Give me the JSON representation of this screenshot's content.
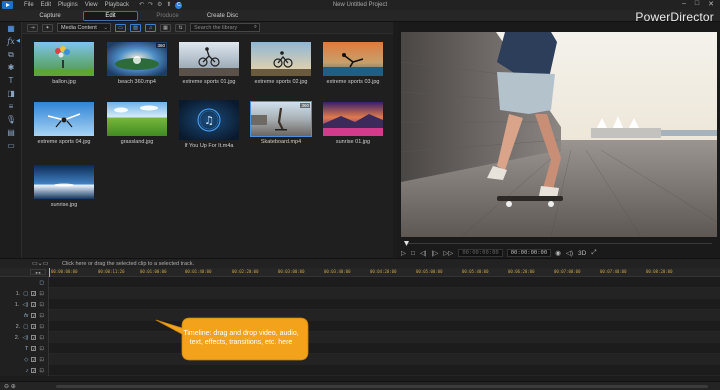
{
  "menu": {
    "items": [
      "File",
      "Edit",
      "Plugins",
      "View",
      "Playback"
    ]
  },
  "window": {
    "project_title": "New Untitled Project",
    "brand": "PowerDirector"
  },
  "modes": [
    "Capture",
    "Edit",
    "Produce",
    "Create Disc"
  ],
  "library": {
    "dropdown_value": "Media Content",
    "search_placeholder": "Search the library",
    "items": [
      {
        "label": "ballon.jpg"
      },
      {
        "label": "beach 360.mp4",
        "badge": "360"
      },
      {
        "label": "extreme sports 01.jpg"
      },
      {
        "label": "extreme sports 02.jpg"
      },
      {
        "label": "extreme sports 03.jpg"
      },
      {
        "label": "extreme sports 04.jpg"
      },
      {
        "label": "grassland.jpg"
      },
      {
        "label": "If You Up For It.m4a"
      },
      {
        "label": "Skateboard.mp4",
        "badge": "360"
      },
      {
        "label": "sunrise 01.jpg"
      },
      {
        "label": "sunrise.jpg"
      }
    ]
  },
  "preview": {
    "timecode_start": "00:00:00:00",
    "timecode_current": "00:00:00:00",
    "mode_3d": "3D"
  },
  "timeline": {
    "hint": "Click here or drag the selected clip to a selected track.",
    "ruler": [
      "00:00:00:00",
      "00:00:11:20",
      "00:01:00:00",
      "00:01:40:00",
      "00:02:20:00",
      "00:03:00:00",
      "00:03:40:00",
      "00:04:20:00",
      "00:05:00:00",
      "00:05:40:00",
      "00:06:20:00",
      "00:07:00:00",
      "00:07:40:00",
      "00:08:20:00"
    ],
    "tracks": [
      {
        "num": "",
        "type": "video-fx",
        "icon": "◻"
      },
      {
        "num": "1.",
        "type": "video",
        "icon": "▢"
      },
      {
        "num": "1.",
        "type": "audio",
        "icon": "◁)"
      },
      {
        "num": "",
        "type": "fx",
        "icon": "fx"
      },
      {
        "num": "2.",
        "type": "video",
        "icon": "▢"
      },
      {
        "num": "2.",
        "type": "audio",
        "icon": "◁)"
      },
      {
        "num": "",
        "type": "title",
        "icon": "T"
      },
      {
        "num": "",
        "type": "voice",
        "icon": "◇"
      },
      {
        "num": "",
        "type": "music",
        "icon": "♪"
      }
    ],
    "callout": "Timeline: drag and drop video, audio, text, effects, transitions, etc. here"
  },
  "colors": {
    "accent": "#3d7fcc",
    "callout": "#f2a21b",
    "playhead": "#d0b050"
  }
}
